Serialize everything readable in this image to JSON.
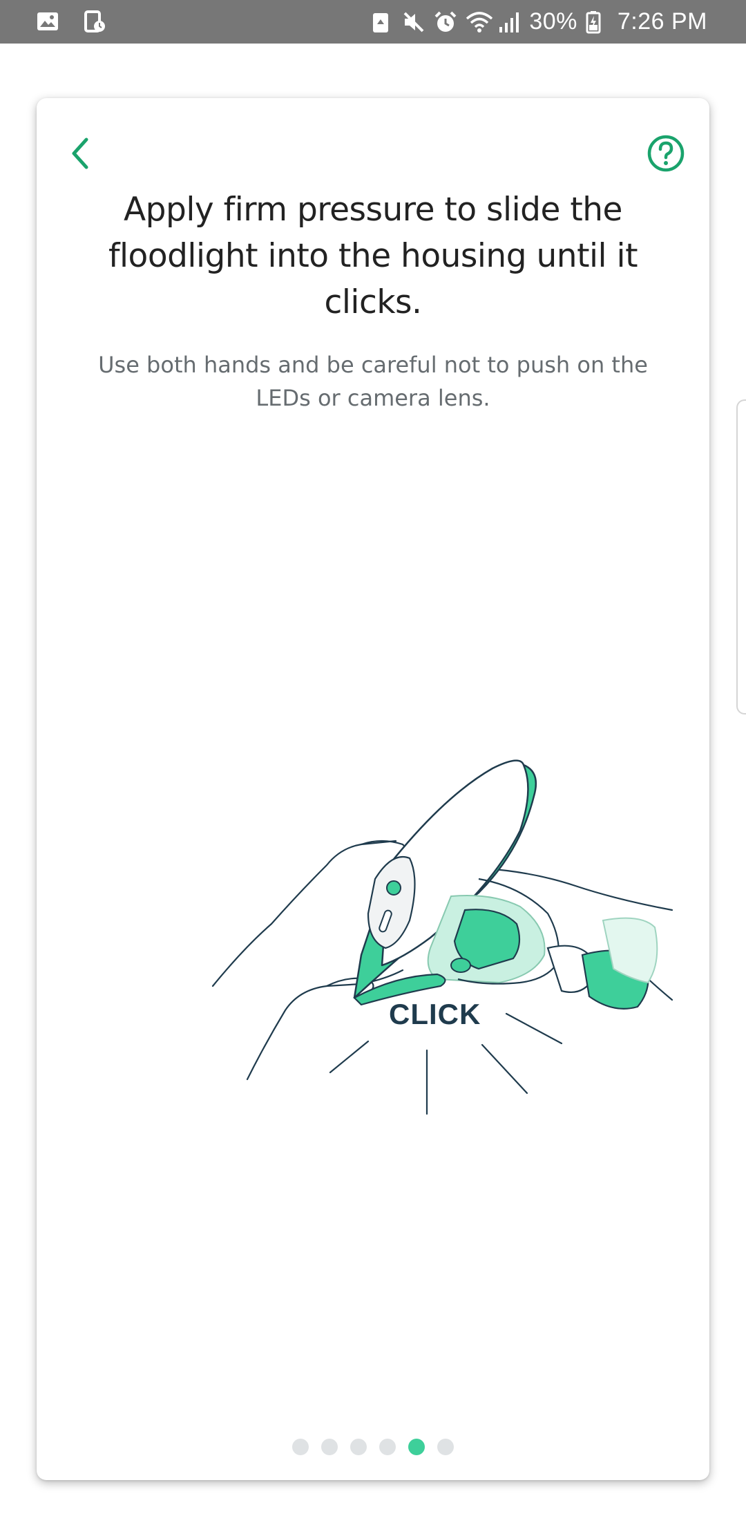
{
  "status_bar": {
    "battery": "30%",
    "time": "7:26 PM",
    "icons": [
      "gallery-icon",
      "screen-record-icon",
      "recycle-icon",
      "mute-icon",
      "alarm-icon",
      "wifi-icon",
      "signal-icon",
      "battery-icon"
    ]
  },
  "screen": {
    "title": "Apply firm pressure to slide the floodlight into the housing until it clicks.",
    "subtitle": "Use both hands and be careful not to push on the LEDs or camera lens.",
    "illustration_label": "CLICK",
    "back_icon": "chevron-left-icon",
    "help_icon": "help-circle-icon"
  },
  "pager": {
    "total": 6,
    "active_index": 4
  },
  "colors": {
    "accent": "#1aa36c",
    "illustration_green": "#3ecf9a",
    "dot_inactive": "#dfe2e4",
    "title": "#222222",
    "subtitle": "#666c70",
    "status_bar": "#777777"
  }
}
